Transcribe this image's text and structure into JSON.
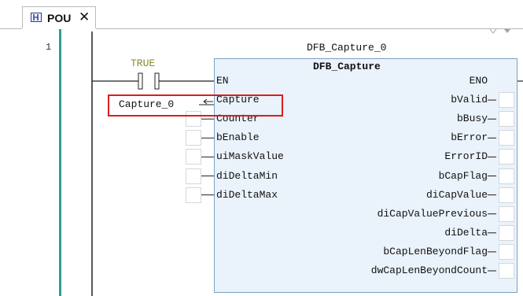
{
  "tab": {
    "title": "POU",
    "close_glyph": "✕",
    "icon": "ladder-pou-icon"
  },
  "editor": {
    "line_number": "1"
  },
  "rung": {
    "contact_label": "TRUE",
    "contact_label_color": "#8a8a2a",
    "input_variable": "Capture_0"
  },
  "function_block": {
    "instance_name": "DFB_Capture_0",
    "type_name": "DFB_Capture",
    "inputs": [
      "EN",
      "Capture",
      "Counter",
      "bEnable",
      "uiMaskValue",
      "diDeltaMin",
      "diDeltaMax"
    ],
    "outputs": [
      "ENO",
      "bValid",
      "bBusy",
      "bError",
      "ErrorID",
      "bCapFlag",
      "diCapValue",
      "diCapValuePrevious",
      "diDelta",
      "bCapLenBeyondFlag",
      "dwCapLenBeyondCount"
    ]
  },
  "colors": {
    "block_fill": "#eaf2fb",
    "block_border": "#7ea1c2",
    "highlight": "#d91e1e",
    "gutter_bar": "#2f9c9e"
  }
}
